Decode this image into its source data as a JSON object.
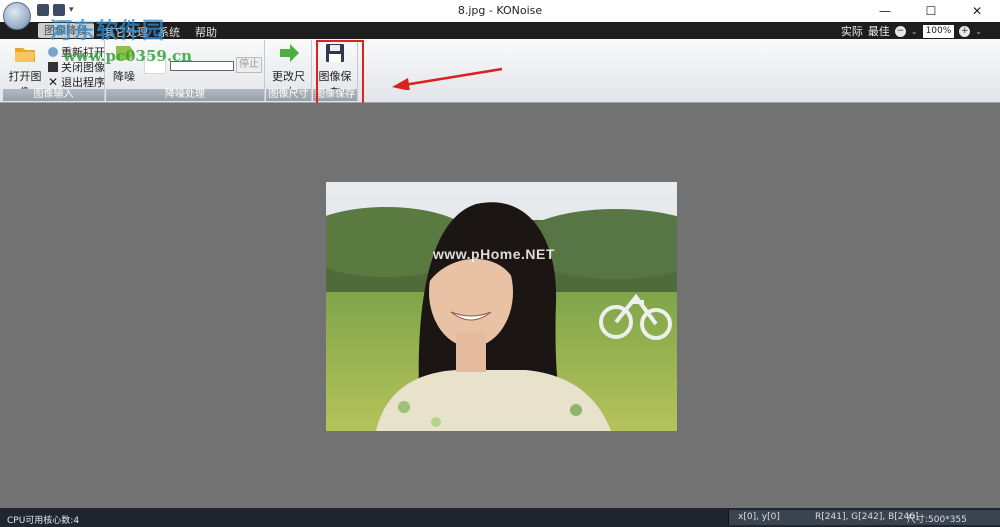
{
  "window": {
    "title": "8.jpg - KONoise",
    "minimize_glyph": "—",
    "maximize_glyph": "☐",
    "close_glyph": "✕"
  },
  "menu": {
    "items": [
      "图像降噪",
      "其它处理",
      "系统",
      "帮助"
    ]
  },
  "zoom": {
    "actual_label": "实际",
    "best_label": "最佳",
    "value": "100%",
    "zoom_out_glyph": "−",
    "zoom_in_glyph": "+",
    "dropdown_glyph": "⌄"
  },
  "ribbon": {
    "groups": {
      "input": {
        "label": "图像输入",
        "open_label": "打开图像",
        "reopen_label": "重新打开",
        "close_label": "关闭图像",
        "exit_label": "退出程序"
      },
      "denoise": {
        "label": "降噪处理",
        "denoise_label": "降噪",
        "stop_label": "停止",
        "progress": 0
      },
      "resize": {
        "label": "图像尺寸",
        "resize_label": "更改尺寸"
      },
      "save": {
        "label": "图像保存",
        "save_label": "图像保存"
      }
    }
  },
  "watermark": {
    "site_name": "河东软件园",
    "site_url": "www.pc0359.cn",
    "photo_watermark": "www.pHome.NET"
  },
  "status": {
    "cpu_cores": "CPU可用核心数:4",
    "coords": "x[0], y[0]",
    "rgb": "R[241], G[242], B[246]",
    "size": "尺寸:500*355"
  },
  "colors": {
    "menubar": "#1e1e1e",
    "canvas": "#727272",
    "highlight": "#e0201a",
    "statusbar": "#1f2630"
  }
}
